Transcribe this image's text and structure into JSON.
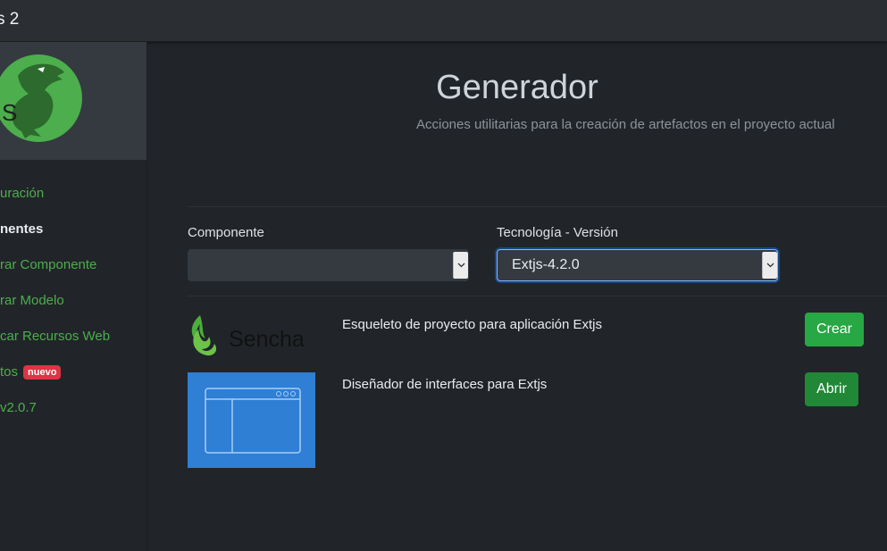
{
  "app": {
    "title": "s 2"
  },
  "sidebar": {
    "logo_icon": "raptor-logo-icon",
    "logo_letter": "S",
    "items": [
      {
        "label": "uración",
        "active": false
      },
      {
        "label": "nentes",
        "active": true
      },
      {
        "label": "rar Componente",
        "active": false
      },
      {
        "label": "rar Modelo",
        "active": false
      },
      {
        "label": "car Recursos Web",
        "active": false
      },
      {
        "label": "tos",
        "active": false,
        "badge": "nuevo"
      },
      {
        "label": "v2.0.7",
        "active": false
      }
    ]
  },
  "main": {
    "title": "Generador",
    "subtitle": "Acciones utilitarias para la creación de artefactos en el proyecto actual",
    "form": {
      "componente_label": "Componente",
      "componente_value": "",
      "tecnologia_label": "Tecnología - Versión",
      "tecnologia_value": "Extjs-4.2.0"
    },
    "rows": [
      {
        "logo_text": "Sencha",
        "description": "Esqueleto de proyecto para aplicación Extjs",
        "button": "Crear"
      },
      {
        "description": "Diseñador de interfaces para Extjs",
        "button": "Abrir"
      }
    ]
  },
  "colors": {
    "background": "#212529",
    "accent_green": "#28a745",
    "badge_red": "#dc3545",
    "focus_blue": "#86b7fe"
  }
}
